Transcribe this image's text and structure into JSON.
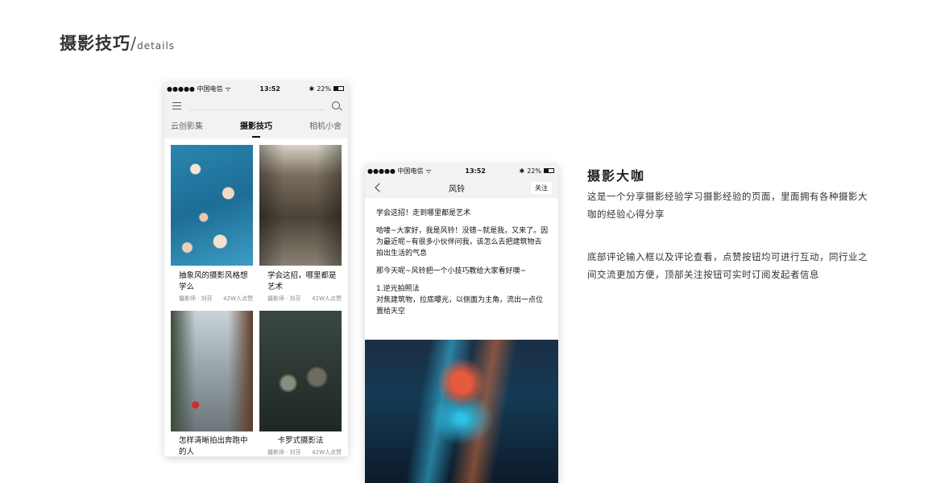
{
  "page": {
    "title": "摄影技巧",
    "slash": "/",
    "subtitle": "details"
  },
  "status_bar": {
    "carrier": "●●●●● 中国电信",
    "wifi": "ᯤ",
    "time": "13:52",
    "bluetooth": "✱",
    "battery": "22%"
  },
  "phone1": {
    "tabs": [
      {
        "label": "云创影集",
        "active": false
      },
      {
        "label": "摄影技巧",
        "active": true
      },
      {
        "label": "相机小舍",
        "active": false
      }
    ],
    "cards": [
      {
        "title": "抽象风的摄影风格想学么",
        "author": "摄影师 · 刘芬",
        "likes": "42W人点赞"
      },
      {
        "title": "学会这招，哪里都是艺术",
        "author": "摄影师 · 刘芬",
        "likes": "42W人点赞"
      },
      {
        "title": "怎样清晰拍出奔跑中的人",
        "author": "",
        "likes": ""
      },
      {
        "title": "卡罗式摄影法",
        "author": "摄影师 · 刘芬",
        "likes": "42W人点赞"
      }
    ]
  },
  "phone2": {
    "nav_title": "风铃",
    "follow_label": "关注",
    "paragraphs": [
      "学会这招！走到哪里都是艺术",
      "哈喽~大家好，我是风铃！没错~就是我，又来了。因为最近呢~有很多小伙伴问我，该怎么去把建筑物去拍出生活的气息",
      "那今天呢~风铃把一个小技巧教给大家看好噢~",
      "1.逆光拍照法\n对焦建筑物，拉底曝光，以侧面为主角，流出一点位置给天空"
    ]
  },
  "side": {
    "title": "摄影大咖",
    "desc1": "这是一个分享摄影经验学习摄影经验的页面，里面拥有各种摄影大咖的经验心得分享",
    "desc2": "底部评论输入框以及评论查看，点赞按钮均可进行互动，同行业之间交流更加方便，顶部关注按钮可实时订阅发起者信息"
  }
}
